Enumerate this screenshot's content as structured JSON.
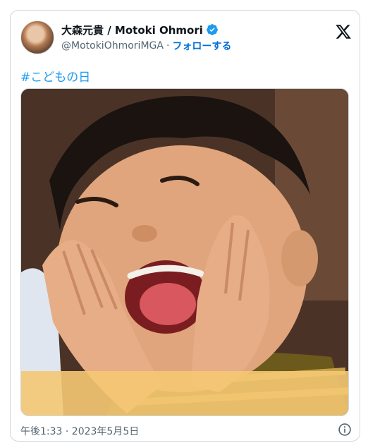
{
  "tweet": {
    "author": {
      "display_name": "大森元貴 / Motoki Ohmori",
      "handle": "@MotokiOhmoriMGA",
      "separator": "·",
      "follow_label": "フォローする",
      "verified": true
    },
    "text": "#こどもの日",
    "media": {
      "kind": "photo"
    },
    "timestamp": "午後1:33 · 2023年5月5日"
  },
  "icons": {
    "avatar": "profile-avatar",
    "verified": "verified-badge-icon",
    "brand": "x-logo-icon",
    "info": "info-icon"
  },
  "colors": {
    "link": "#1d9bf0",
    "follow": "#006fd6",
    "verified": "#1d9bf0",
    "text": "#0f1419",
    "muted": "#536471",
    "border": "#cfd9de"
  }
}
